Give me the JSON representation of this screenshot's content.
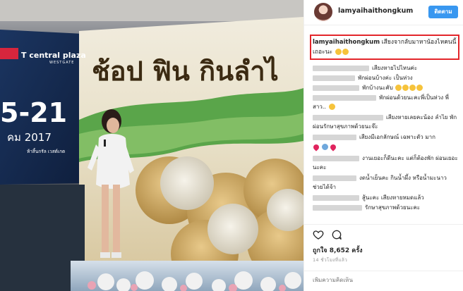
{
  "photo": {
    "brand": "central plaza",
    "brand_prefix": "T",
    "brand_sub": "WESTGATE",
    "dates": "5-21",
    "month": "คม 2017",
    "venue": "ห้าสิ้นกรัล เวสต์เกต",
    "headline": "ช้อป ฟิน กินลำไ"
  },
  "post": {
    "username": "lamyaihaithongkum",
    "follow_label": "ติดตาม",
    "caption_username": "lamyaihaithongkum",
    "caption_text": "เสียงจากลับมาหาน้องไหคนนี้เถอะนะ",
    "comments": [
      {
        "text": "เสียงหายไปไหนค่ะ"
      },
      {
        "text": "พักผ่อนบ้างค่ะ เป็นห่วง"
      },
      {
        "text": "พักบ้างนะคับ"
      },
      {
        "text": "พักผ่อนด้วยนะคะพี่เป็นห่วง พี่สาว.."
      },
      {
        "text": "เสียงหายเลยคะน้อง ลำไย พักผ่อนรักษาสุขภาพด้วยนะจ๊ะ"
      },
      {
        "text": "เสียงมีเอกลักษณ์ เฉพาะตัว มาก"
      },
      {
        "text": ""
      },
      {
        "text": "งานเยอะก็ดีนะคะ แต่ก็ต้องพัก ผ่อนเยอะนะคะ"
      },
      {
        "text": "งดน้ำเย็นคะ กินน้ำผึ้ง หรือน้ำมะนาว ช่วยได้จ้า"
      },
      {
        "text": "สู้นะคะ เสียงหายหมดแล้ว"
      },
      {
        "text": "รักษาสุขภาพด้วยนะคะ"
      }
    ],
    "likes": "ถูกใจ 8,652 ครั้ง",
    "timestamp": "14 ชั่วโมงที่แล้ว",
    "add_comment_placeholder": "เพิ่มความคิดเห็น"
  },
  "colors": {
    "accent": "#3897f0",
    "highlight_border": "#e3262b"
  },
  "icons": [
    "heart-icon",
    "comment-icon"
  ]
}
